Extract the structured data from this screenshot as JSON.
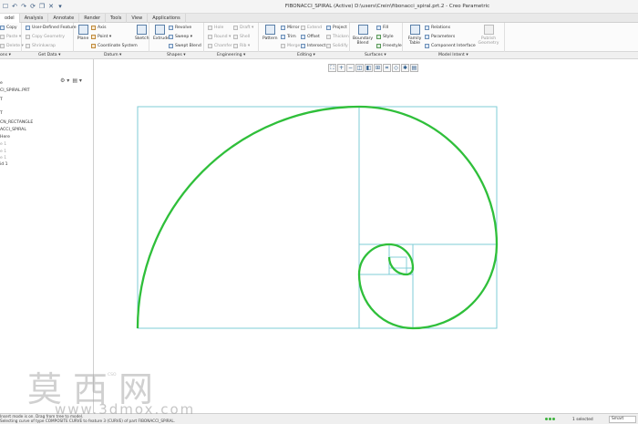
{
  "window": {
    "title": "FIBONACCI_SPIRAL (Active) D:\\users\\Crein\\fibonacci_spiral.prt.2 - Creo Parametric"
  },
  "quick_access": {
    "icons": [
      "new-icon",
      "undo-icon",
      "redo-icon",
      "regenerate-icon",
      "windows-icon",
      "close-icon",
      "customize-icon"
    ],
    "glyphs": [
      "☐",
      "↶",
      "↷",
      "⟳",
      "❐",
      "✕",
      "▾"
    ]
  },
  "tabs": [
    {
      "label": "odel"
    },
    {
      "label": "Analysis"
    },
    {
      "label": "Annotate"
    },
    {
      "label": "Render"
    },
    {
      "label": "Tools"
    },
    {
      "label": "View"
    },
    {
      "label": "Applications"
    }
  ],
  "ribbon": {
    "operations": {
      "copy": "Copy",
      "paste": "Paste ▾",
      "delete": "Delete ▾"
    },
    "get_data": {
      "udf": "User-Defined Feature",
      "copy_geom": "Copy Geometry",
      "shrinkwrap": "Shrinkwrap"
    },
    "datum": {
      "plane": "Plane",
      "axis": "Axis",
      "point": "Point ▾",
      "csys": "Coordinate System",
      "sketch": "Sketch"
    },
    "shapes": {
      "extrude": "Extrude",
      "revolve": "Revolve",
      "sweep": "Sweep ▾",
      "swept_blend": "Swept Blend"
    },
    "engineering": {
      "hole": "Hole",
      "round": "Round ▾",
      "chamfer": "Chamfer ▾",
      "draft": "Draft ▾",
      "shell": "Shell",
      "rib": "Rib ▾"
    },
    "editing": {
      "pattern": "Pattern",
      "mirror": "Mirror",
      "trim": "Trim",
      "merge": "Merge",
      "extend": "Extend",
      "offset": "Offset",
      "intersect": "Intersect",
      "project": "Project",
      "thicken": "Thicken",
      "solidify": "Solidify"
    },
    "surfaces": {
      "boundary_blend": "Boundary Blend",
      "fill": "Fill",
      "style": "Style",
      "freestyle": "Freestyle"
    },
    "model_intent": {
      "family_table": "Family Table",
      "relations": "Relations",
      "parameters": "Parameters",
      "component_interface": "Component Interface",
      "publish_geometry": "Publish Geometry"
    }
  },
  "group_labels": {
    "operations": "ons ▾",
    "get_data": "Get Data ▾",
    "datum": "Datum ▾",
    "shapes": "Shapes ▾",
    "engineering": "Engineering ▾",
    "editing": "Editing ▾",
    "surfaces": "Surfaces ▾",
    "model_intent": "Model Intent ▾"
  },
  "graphics_toolbar": {
    "icons": [
      "refit-icon",
      "zoom-in-icon",
      "zoom-out-icon",
      "repaint-icon",
      "display-style-icon",
      "saved-views-icon",
      "view-manager-icon",
      "datum-display-icon",
      "spin-center-icon",
      "annotation-display-icon"
    ],
    "glyphs": [
      "⛶",
      "+",
      "−",
      "◫",
      "◧",
      "⊞",
      "⌗",
      "◇",
      "✱",
      "▤"
    ]
  },
  "model_tree": {
    "tools": [
      "⚙ ▾",
      "▤ ▾"
    ],
    "items": [
      {
        "label": "e"
      },
      {
        "label": "CI_SPIRAL.PRT"
      },
      {
        "label": "T"
      },
      {
        "label": "T"
      },
      {
        "label": "CN_RECTANGLE"
      },
      {
        "label": "ACCI_SPIRAL"
      },
      {
        "label": "Here"
      },
      {
        "label": "e 1"
      },
      {
        "label": "e 1"
      },
      {
        "label": "e 1"
      },
      {
        "label": "id 1"
      }
    ]
  },
  "graphics": {
    "faint_label": "CSO",
    "rect_color": "#7ecbd6",
    "spiral_color": "#2fbf3a"
  },
  "status": {
    "line1": "Insert mode is on. Drag from tree to model.",
    "line2": "Selecting curve of type COMPOSITE CURVE to feature 3 (CURVE) of part FIBONACCI_SPIRAL.",
    "selected": "1 selected",
    "filter": "Smart"
  },
  "watermark": {
    "text": "莫西网",
    "url": "www.3dmox.com"
  }
}
